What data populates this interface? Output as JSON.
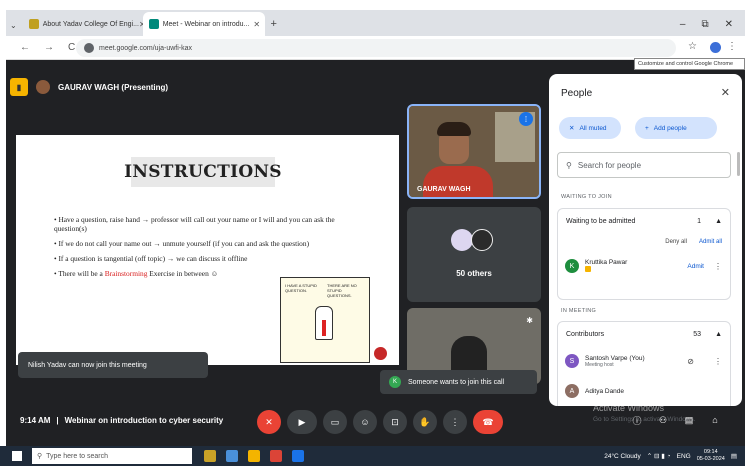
{
  "browser": {
    "tabs": [
      {
        "label": "About Yadav College Of Engi...",
        "active": false
      },
      {
        "label": "Meet - Webinar on introdu...",
        "active": true
      }
    ],
    "new_tab": "+",
    "url": "meet.google.com/uja-uwfi-kax",
    "tooltip": "Customize and control Google Chrome",
    "window_controls": [
      "–",
      "⧉",
      "✕"
    ]
  },
  "meet": {
    "presenter": "GAURAV WAGH (Presenting)",
    "slide": {
      "title": "INSTRUCTIONS",
      "bullets": [
        "Have a question, raise hand → professor will call out your name or I will and you can ask the question(s)",
        "If we do not call your name out → unmute yourself  (if you can and ask the question)",
        "If a question is tangential (off topic) → we can discuss it offline",
        "There will be a "
      ],
      "brainstorm_word": "Brainstorming",
      "bullet4_tail": " Exercise in between ☺",
      "comic_left": "I HAVE A STUPID QUESTION.",
      "comic_right": "THERE ARE NO STUPID QUESTIONS."
    },
    "tiles": {
      "main_name": "GAURAV WAGH",
      "others": "50 others"
    },
    "toast_join": "Nilish Yadav can now join this meeting",
    "toast_request": "Someone wants to join this call",
    "toast_request_avatar": "K",
    "time": "9:14 AM",
    "separator": "|",
    "meeting_title": "Webinar on introduction to cyber security",
    "watermark_title": "Activate Windows",
    "watermark_sub": "Go to Settings to activate Windows."
  },
  "people": {
    "title": "People",
    "all_muted": "All muted",
    "add_people": "Add people",
    "search_placeholder": "Search for people",
    "waiting_section": "WAITING TO JOIN",
    "waiting_label": "Waiting to be admitted",
    "waiting_count": "1",
    "deny_all": "Deny all",
    "admit_all": "Admit all",
    "waiting_person": {
      "initial": "K",
      "name": "Kruttika Pawar",
      "admit": "Admit"
    },
    "in_meeting_section": "IN MEETING",
    "contributors_label": "Contributors",
    "contributors_count": "53",
    "members": [
      {
        "initial": "S",
        "name": "Santosh Varpe (You)",
        "sub": "Meeting host",
        "color": "#7e57c2"
      },
      {
        "initial": "A",
        "name": "Aditya Dande",
        "sub": "",
        "color": "#8d6e63"
      }
    ]
  },
  "taskbar": {
    "search_placeholder": "Type here to search",
    "weather": "24°C  Cloudy",
    "lang": "ENG",
    "clock_time": "09:14",
    "clock_date": "05-03-2024"
  },
  "colors": {
    "meet_bg": "#202124",
    "accent_blue": "#1a73e8",
    "end_call": "#ea4335",
    "pill_bg": "#d3e3fd"
  }
}
